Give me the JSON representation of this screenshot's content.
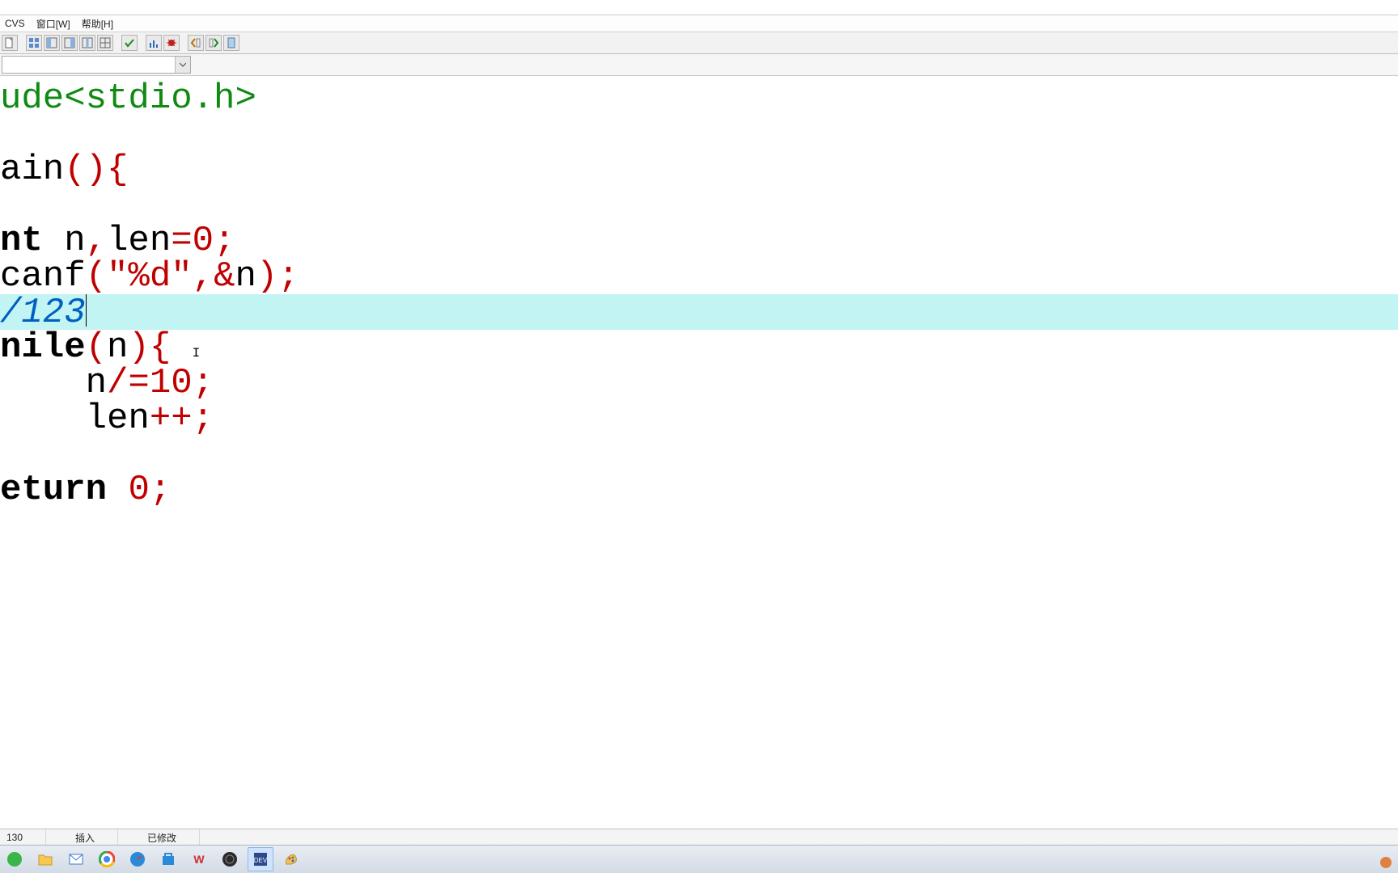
{
  "menubar": {
    "items": [
      "CVS",
      "窗口[W]",
      "帮助[H]"
    ]
  },
  "toolbar": {
    "buttons": [
      "file-icon",
      "sep",
      "grid-icon",
      "panel-left-icon",
      "panel-right-icon",
      "panel-split-icon",
      "panel-tile-icon",
      "sep",
      "check-icon",
      "sep",
      "barchart-icon",
      "bug-icon",
      "sep",
      "indent-left-icon",
      "indent-right-icon",
      "page-icon"
    ]
  },
  "combo": {
    "value": ""
  },
  "code": {
    "lines": [
      {
        "seg": [
          {
            "t": "ude",
            "c": "pre"
          },
          {
            "t": "<stdio.h>",
            "c": "pre"
          }
        ]
      },
      {
        "seg": [
          {
            "t": "",
            "c": "id"
          }
        ]
      },
      {
        "seg": [
          {
            "t": "ain",
            "c": "id"
          },
          {
            "t": "(){",
            "c": "op"
          }
        ]
      },
      {
        "seg": [
          {
            "t": "",
            "c": "id"
          }
        ]
      },
      {
        "seg": [
          {
            "t": "nt ",
            "c": "kw"
          },
          {
            "t": "n",
            "c": "id"
          },
          {
            "t": ",",
            "c": "op"
          },
          {
            "t": "len",
            "c": "id"
          },
          {
            "t": "=",
            "c": "op"
          },
          {
            "t": "0",
            "c": "num"
          },
          {
            "t": ";",
            "c": "op"
          }
        ]
      },
      {
        "seg": [
          {
            "t": "canf",
            "c": "id"
          },
          {
            "t": "(",
            "c": "op"
          },
          {
            "t": "\"%d\"",
            "c": "str"
          },
          {
            "t": ",",
            "c": "op"
          },
          {
            "t": "&",
            "c": "op"
          },
          {
            "t": "n",
            "c": "id"
          },
          {
            "t": ");",
            "c": "op"
          }
        ]
      },
      {
        "hl": true,
        "seg": [
          {
            "t": "/123",
            "c": "cmt"
          }
        ],
        "caret": true
      },
      {
        "seg": [
          {
            "t": "nile",
            "c": "kw"
          },
          {
            "t": "(",
            "c": "op"
          },
          {
            "t": "n",
            "c": "id"
          },
          {
            "t": "){",
            "c": "op"
          },
          {
            "t": " ",
            "c": "id"
          }
        ],
        "tinyI": true
      },
      {
        "seg": [
          {
            "t": "    n",
            "c": "id"
          },
          {
            "t": "/=",
            "c": "op"
          },
          {
            "t": "10",
            "c": "num"
          },
          {
            "t": ";",
            "c": "op"
          }
        ]
      },
      {
        "seg": [
          {
            "t": "    len",
            "c": "id"
          },
          {
            "t": "++;",
            "c": "op"
          }
        ]
      },
      {
        "seg": [
          {
            "t": "",
            "c": "id"
          }
        ]
      },
      {
        "seg": [
          {
            "t": "eturn ",
            "c": "kw"
          },
          {
            "t": "0",
            "c": "num"
          },
          {
            "t": ";",
            "c": "op"
          }
        ]
      }
    ]
  },
  "statusbar": {
    "col": "130",
    "mode": "插入",
    "state": "已修改"
  },
  "taskbar": {
    "icons": [
      "start-icon",
      "folder-icon",
      "mail-icon",
      "chrome-icon",
      "safari-icon",
      "store-icon",
      "w-icon",
      "obs-icon",
      "dev-icon",
      "paint-icon"
    ],
    "active_index": 8
  }
}
